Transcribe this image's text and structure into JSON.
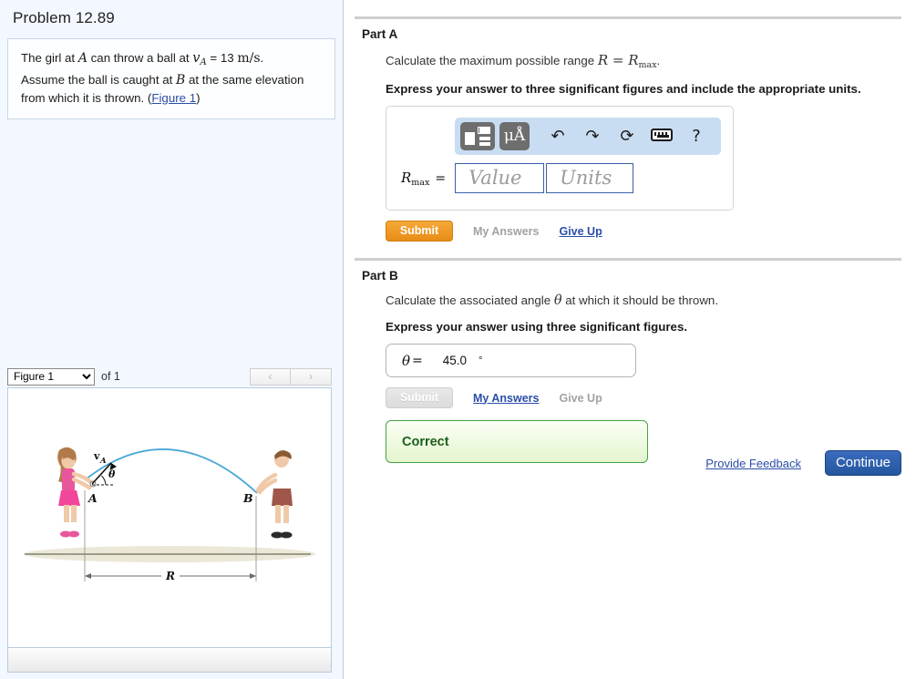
{
  "problem": {
    "title": "Problem 12.89",
    "statement_pre": "The girl at ",
    "statement_A": "A",
    "statement_mid1": " can throw a ball at ",
    "vA": "v",
    "vA_sub": "A",
    "eq": " = ",
    "speed": "13",
    "speed_units": "m/s",
    "period": ".",
    "statement_line2_pre": "Assume the ball is caught at ",
    "statement_B": "B",
    "statement_line2_post": " at the same elevation from which it is thrown. (",
    "figure_link": "Figure 1",
    "statement_close": ")"
  },
  "figure_panel": {
    "selected": "Figure 1",
    "options": [
      "Figure 1"
    ],
    "of_label": "of 1",
    "prev_icon": "chevron-left-icon",
    "next_icon": "chevron-right-icon",
    "prev_glyph": "‹",
    "next_glyph": "›",
    "labels": {
      "vA": "v",
      "vA_sub": "A",
      "theta": "θ",
      "A": "A",
      "B": "B",
      "R": "R"
    },
    "colors": {
      "trajectory": "#4aa8d8",
      "girl_dress": "#e8569b",
      "girl_hair": "#b07a4a",
      "boy_shorts": "#a0564a",
      "ground": "#e8e4d4"
    }
  },
  "partA": {
    "heading": "Part A",
    "question_pre": "Calculate the maximum possible range ",
    "question_math": "R = R",
    "question_math_sub": "max",
    "question_post": ".",
    "instruction": "Express your answer to three significant figures and include the appropriate units.",
    "answer_label": "R",
    "answer_label_sub": "max",
    "equals": "=",
    "value_placeholder": "Value",
    "units_placeholder": "Units",
    "value": "",
    "units": "",
    "toolbar": {
      "template_icon": "math-template-icon",
      "units_icon": "micro-angstrom-units-icon",
      "units_label": "μÅ",
      "undo_icon": "undo-arrow-icon",
      "undo_glyph": "↶",
      "redo_icon": "redo-arrow-icon",
      "redo_glyph": "↷",
      "reset_icon": "reset-circular-arrow-icon",
      "reset_glyph": "⟳",
      "keyboard_icon": "keyboard-icon",
      "help_icon": "help-question-icon",
      "help_glyph": "?"
    },
    "submit_label": "Submit",
    "my_answers_label": "My Answers",
    "give_up_label": "Give Up"
  },
  "partB": {
    "heading": "Part B",
    "question_pre": "Calculate the associated angle ",
    "question_theta": "θ",
    "question_post": " at which it should be thrown.",
    "instruction": "Express your answer using three significant figures.",
    "answer_label": "θ",
    "equals": "=",
    "value": "45.0",
    "units": "°",
    "submit_label": "Submit",
    "my_answers_label": "My Answers",
    "give_up_label": "Give Up",
    "feedback_status": "Correct"
  },
  "footer": {
    "feedback_label": "Provide Feedback",
    "continue_label": "Continue"
  },
  "colors": {
    "accent_orange": "#ea8f1a",
    "link_blue": "#2b4ea8",
    "continue_blue": "#2b5fa8",
    "correct_green": "#1c5e1c",
    "panel_bg": "#f3f7ff"
  }
}
